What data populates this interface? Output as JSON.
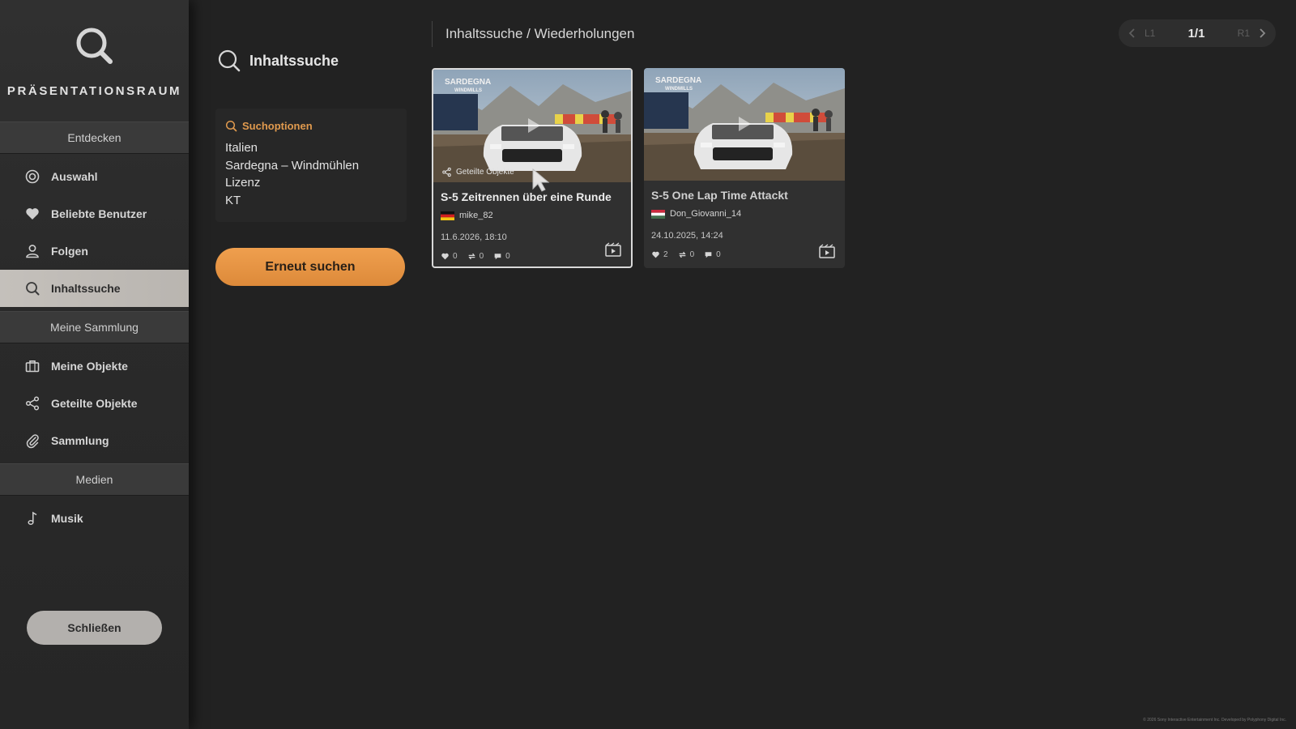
{
  "sidebar": {
    "brand_title": "PRÄSENTATIONSRAUM",
    "sections": [
      {
        "header": "Entdecken",
        "items": [
          {
            "label": "Auswahl",
            "icon": "selection-icon",
            "active": false
          },
          {
            "label": "Beliebte Benutzer",
            "icon": "heart-icon",
            "active": false
          },
          {
            "label": "Folgen",
            "icon": "person-icon",
            "active": false
          },
          {
            "label": "Inhaltssuche",
            "icon": "search-icon",
            "active": true
          }
        ]
      },
      {
        "header": "Meine Sammlung",
        "items": [
          {
            "label": "Meine Objekte",
            "icon": "briefcase-icon",
            "active": false
          },
          {
            "label": "Geteilte Objekte",
            "icon": "share-icon",
            "active": false
          },
          {
            "label": "Sammlung",
            "icon": "paperclip-icon",
            "active": false
          }
        ]
      },
      {
        "header": "Medien",
        "items": [
          {
            "label": "Musik",
            "icon": "music-note-icon",
            "active": false
          }
        ]
      }
    ],
    "close_label": "Schließen"
  },
  "search_panel": {
    "title": "Inhaltssuche",
    "options_label": "Suchoptionen",
    "options": [
      "Italien",
      "Sardegna – Windmühlen",
      "Lizenz",
      "KT"
    ],
    "search_again_label": "Erneut suchen"
  },
  "header": {
    "breadcrumb": "Inhaltssuche / Wiederholungen",
    "pager": {
      "prev_label": "L1",
      "page": "1/1",
      "next_label": "R1"
    }
  },
  "results": [
    {
      "title": "S-5 Zeitrennen über eine Runde",
      "user": "mike_82",
      "flag": "germany",
      "date": "11.6.2026, 18:10",
      "likes": "0",
      "reposts": "0",
      "comments": "0",
      "shared_label": "Geteilte Objekte",
      "track_logo": "SARDEGNA",
      "track_logo_sub": "WINDMILLS"
    },
    {
      "title": "S-5 One Lap Time Attackt",
      "user": "Don_Giovanni_14",
      "flag": "hungary",
      "date": "24.10.2025, 14:24",
      "likes": "2",
      "reposts": "0",
      "comments": "0",
      "track_logo": "SARDEGNA",
      "track_logo_sub": "WINDMILLS"
    }
  ],
  "footer": {
    "copyright": "© 2026 Sony Interactive Entertainment Inc. Developed by Polyphony Digital Inc."
  },
  "colors": {
    "accent_orange": "#e09a4e",
    "active_nav": "#c4c0bb",
    "background": "#222222"
  }
}
